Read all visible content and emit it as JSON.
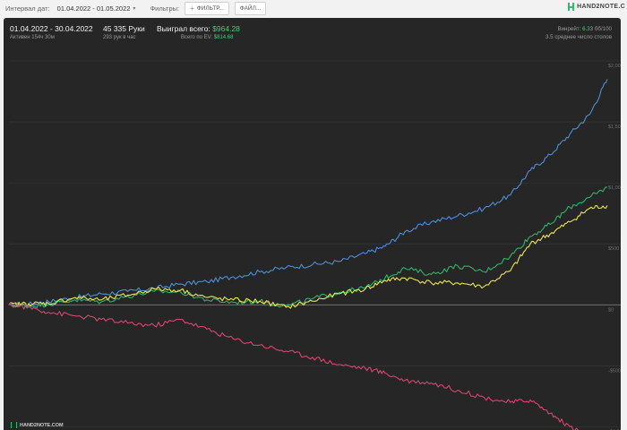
{
  "toolbar": {
    "interval_label": "Интервал дат:",
    "date_range": "01.04.2022 - 01.05.2022",
    "filters_label": "Фильтры:",
    "filter_button": "ФИЛЬТР...",
    "file_button": "ФАЙЛ..."
  },
  "logo": {
    "text": "HAND2NOTE.C"
  },
  "stats": {
    "period": "01.04.2022 - 30.04.2022",
    "active": "Активен 154ч 30м",
    "hands": "45 335 Руки",
    "hands_per_hour": "293 рук в час",
    "won_label": "Выиграл всего:",
    "won_value": "$964.28",
    "ev_label": "Всего по EV:",
    "ev_value": "$814.68",
    "winrate_label": "Винрейт:",
    "winrate_value": "6.33",
    "winrate_suffix": "бб/100",
    "avg_tables": "3.5 среднее число столов"
  },
  "watermark": "HAND2NOTE.COM",
  "colors": {
    "blue": "#4a90d9",
    "green": "#2fb36a",
    "yellow": "#e9e64a",
    "red": "#d9456f",
    "grid": "#3a3a3a",
    "zero": "#8a8a8a"
  },
  "chart_data": {
    "type": "line",
    "x_label": "",
    "xlim": [
      0,
      45335
    ],
    "ylim": [
      -1100,
      2000
    ],
    "y_ticks": [
      {
        "value": 2000,
        "label": "$2,000"
      },
      {
        "value": 1500,
        "label": "$1,500"
      },
      {
        "value": 1000,
        "label": "$1,000"
      },
      {
        "value": 500,
        "label": "$500"
      },
      {
        "value": 0,
        "label": "$0"
      },
      {
        "value": -500,
        "label": "-$500"
      },
      {
        "value": -1000,
        "label": "-$1,000"
      }
    ],
    "series": [
      {
        "color": "#4a90d9",
        "x": [
          0,
          1500,
          3000,
          5000,
          7000,
          9000,
          11000,
          13000,
          15000,
          17000,
          19000,
          21000,
          23000,
          25000,
          27000,
          28500,
          30000,
          32000,
          34000,
          36000,
          38000,
          39500,
          41000,
          42500,
          44000,
          45335
        ],
        "values": [
          0,
          5,
          25,
          60,
          90,
          110,
          135,
          170,
          190,
          230,
          270,
          305,
          330,
          355,
          420,
          480,
          600,
          680,
          730,
          790,
          900,
          1100,
          1230,
          1400,
          1560,
          1850
        ]
      },
      {
        "color": "#2fb36a",
        "x": [
          0,
          1500,
          3000,
          5000,
          7000,
          9000,
          11000,
          13000,
          15000,
          17000,
          19000,
          21000,
          23000,
          25000,
          27000,
          28500,
          30000,
          32000,
          34000,
          36000,
          38000,
          39500,
          41000,
          42500,
          44000,
          45335
        ],
        "values": [
          0,
          -10,
          5,
          40,
          25,
          70,
          110,
          105,
          40,
          20,
          30,
          -10,
          50,
          100,
          140,
          220,
          300,
          250,
          320,
          270,
          400,
          560,
          660,
          800,
          880,
          964.28
        ]
      },
      {
        "color": "#e9e64a",
        "x": [
          0,
          1500,
          3000,
          5000,
          7000,
          9000,
          11000,
          13000,
          15000,
          17000,
          19000,
          21000,
          23000,
          25000,
          27000,
          28500,
          30000,
          32000,
          34000,
          36000,
          38000,
          39500,
          41000,
          42500,
          44000,
          45335
        ],
        "values": [
          0,
          10,
          10,
          60,
          40,
          80,
          130,
          120,
          60,
          40,
          30,
          -20,
          30,
          90,
          130,
          200,
          220,
          180,
          180,
          150,
          280,
          500,
          580,
          680,
          790,
          814.68
        ]
      },
      {
        "color": "#d9456f",
        "x": [
          0,
          1500,
          3000,
          5000,
          7000,
          9000,
          11000,
          13000,
          15000,
          17000,
          19000,
          21000,
          23000,
          25000,
          27000,
          28500,
          30000,
          32000,
          34000,
          36000,
          38000,
          39500,
          41000,
          42500,
          44000,
          45335
        ],
        "values": [
          0,
          -20,
          -60,
          -90,
          -120,
          -150,
          -170,
          -120,
          -200,
          -280,
          -330,
          -380,
          -430,
          -490,
          -520,
          -560,
          -620,
          -640,
          -700,
          -760,
          -800,
          -780,
          -890,
          -1000,
          -1080,
          -1105
        ]
      }
    ]
  }
}
